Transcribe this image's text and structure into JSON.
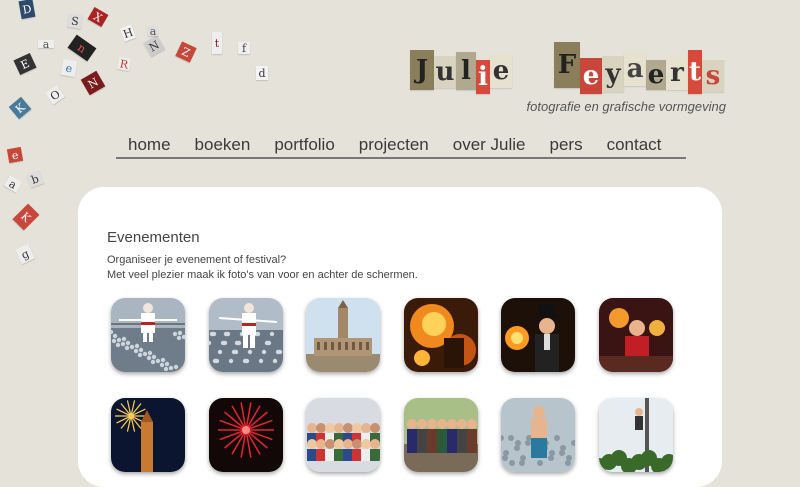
{
  "scatter_letters": [
    "D",
    "S",
    "X",
    "a",
    "H",
    "N",
    "Z",
    "t",
    "n",
    "E",
    "e",
    "N",
    "R",
    "f",
    "d",
    "O",
    "K",
    "e",
    "a",
    "b",
    "K",
    "g",
    "a"
  ],
  "logo": {
    "first": [
      "J",
      "u",
      "l",
      "i",
      "e"
    ],
    "last": [
      "F",
      "e",
      "y",
      "a",
      "e",
      "r",
      "t",
      "s"
    ]
  },
  "tagline": "fotografie en grafische vormgeving",
  "nav": [
    "home",
    "boeken",
    "portfolio",
    "projecten",
    "over Julie",
    "pers",
    "contact"
  ],
  "section": {
    "title": "Evenementen",
    "line1": "Organiseer je evenement of festival?",
    "line2": "Met veel plezier maak ik foto's van voor en achter de schermen."
  },
  "colors": {
    "background": "#e4e2d9",
    "panel": "#ffffff",
    "nav_text": "#3a3a3a",
    "accent_red": "#c8463a"
  },
  "thumbnails": [
    {
      "subject": "tightrope-walker-crowd"
    },
    {
      "subject": "tightrope-walker-crowd-2"
    },
    {
      "subject": "university-library-tower"
    },
    {
      "subject": "fire-performer"
    },
    {
      "subject": "fire-performer-top-hat"
    },
    {
      "subject": "fire-dancer-red"
    },
    {
      "subject": "fireworks-tower"
    },
    {
      "subject": "red-fireworks"
    },
    {
      "subject": "street-crowd"
    },
    {
      "subject": "street-performers"
    },
    {
      "subject": "acrobat-crowd"
    },
    {
      "subject": "aerial-act"
    }
  ]
}
